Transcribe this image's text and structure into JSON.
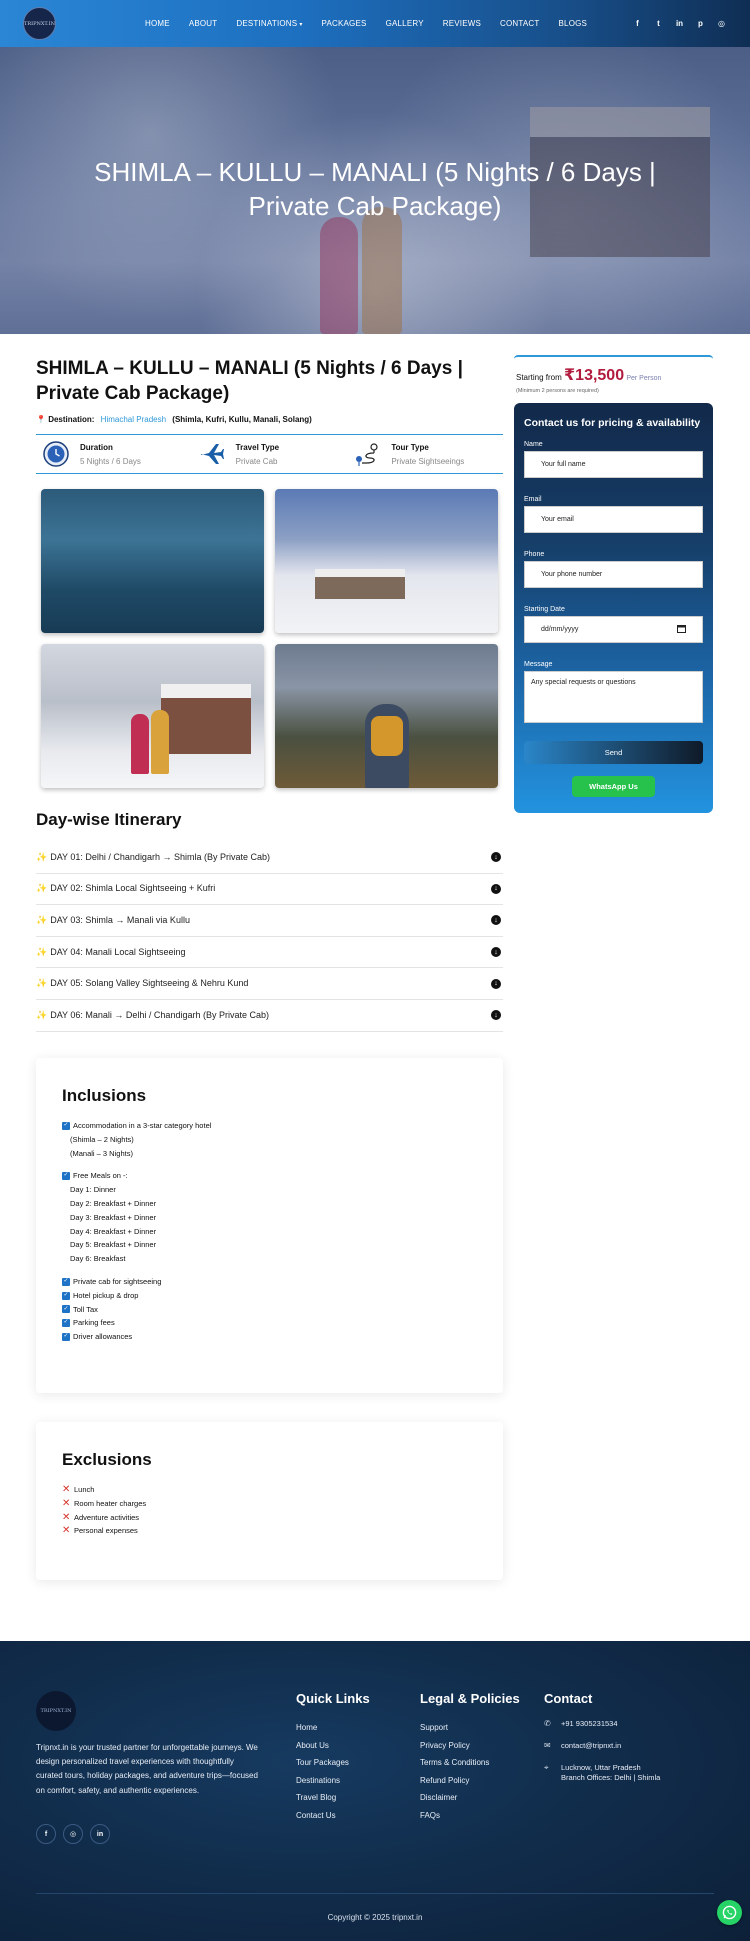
{
  "brand": {
    "logo_text": "TRIPNXT.IN"
  },
  "nav": {
    "items": [
      "HOME",
      "ABOUT",
      "DESTINATIONS",
      "PACKAGES",
      "GALLERY",
      "REVIEWS",
      "CONTACT",
      "BLOGS"
    ],
    "destinations_caret": "▾"
  },
  "social_top": [
    "f",
    "t",
    "in",
    "p",
    "◎"
  ],
  "hero": {
    "title": "SHIMLA – KULLU – MANALI (5 Nights / 6 Days | Private Cab Package)"
  },
  "package": {
    "title": "SHIMLA – KULLU – MANALI (5 Nights / 6 Days | Private Cab Package)",
    "destination_label": "Destination:",
    "destination_value": "Himachal Pradesh",
    "destination_places": "(Shimla, Kufri, Kullu, Manali, Solang)",
    "stats": [
      {
        "title": "Duration",
        "value": "5 Nights / 6 Days",
        "icon": "clock-icon"
      },
      {
        "title": "Travel Type",
        "value": "Private Cab",
        "icon": "plane-icon"
      },
      {
        "title": "Tour Type",
        "value": "Private Sightseeings",
        "icon": "route-icon"
      }
    ]
  },
  "itinerary": {
    "title": "Day-wise Itinerary",
    "days": [
      "DAY 01: Delhi / Chandigarh → Shimla (By Private Cab)",
      "DAY 02: Shimla Local Sightseeing + Kufri",
      "DAY 03: Shimla → Manali via Kullu",
      "DAY 04: Manali Local Sightseeing",
      "DAY 05: Solang Valley Sightseeing & Nehru Kund",
      "DAY 06: Manali → Delhi / Chandigarh (By Private Cab)"
    ]
  },
  "inclusions": {
    "title": "Inclusions",
    "accommodation": "Accommodation in a 3-star category hotel",
    "accommodation_sub": [
      "(Shimla – 2 Nights)",
      "(Manali – 3 Nights)"
    ],
    "meals": "Free Meals on -:",
    "meals_sub": [
      "Day 1: Dinner",
      "Day 2: Breakfast + Dinner",
      "Day 3: Breakfast + Dinner",
      "Day 4: Breakfast + Dinner",
      "Day 5: Breakfast + Dinner",
      "Day 6: Breakfast"
    ],
    "others": [
      "Private cab for sightseeing",
      "Hotel pickup & drop",
      "Toll Tax",
      "Parking fees",
      "Driver allowances"
    ]
  },
  "exclusions": {
    "title": "Exclusions",
    "items": [
      "Lunch",
      "Room heater charges",
      "Adventure activities",
      "Personal expenses"
    ]
  },
  "pricing": {
    "starting_from": "Starting from",
    "amount": "₹13,500",
    "per": "Per Person",
    "min_note": "(Minimum 2 persons are required)"
  },
  "form": {
    "title": "Contact us for pricing & availability",
    "name_label": "Name",
    "name_placeholder": "Your full name",
    "email_label": "Email",
    "email_placeholder": "Your email",
    "phone_label": "Phone",
    "phone_placeholder": "Your phone number",
    "date_label": "Starting Date",
    "date_placeholder": "dd/mm/yyyy",
    "message_label": "Message",
    "message_placeholder": "Any special requests or questions",
    "send": "Send",
    "whatsapp": "WhatsApp Us"
  },
  "footer": {
    "logo_text": "TRIPNXT.IN",
    "description": "Tripnxt.in is your trusted partner for unforgettable journeys. We design personalized travel experiences with thoughtfully curated tours, holiday packages, and adventure trips—focused on comfort, safety, and authentic experiences.",
    "social": [
      "f",
      "◎",
      "in"
    ],
    "quick_links_title": "Quick Links",
    "quick_links": [
      "Home",
      "About Us",
      "Tour Packages",
      "Destinations",
      "Travel Blog",
      "Contact Us"
    ],
    "legal_title": "Legal & Policies",
    "legal": [
      "Support",
      "Privacy Policy",
      "Terms & Conditions",
      "Refund Policy",
      "Disclaimer",
      "FAQs"
    ],
    "contact_title": "Contact",
    "phone": "+91 9305231534",
    "email": "contact@tripnxt.in",
    "address_line1": "Lucknow, Uttar Pradesh",
    "address_line2": "Branch Offices: Delhi | Shimla",
    "copyright": "Copyright © 2025 tripnxt.in"
  }
}
